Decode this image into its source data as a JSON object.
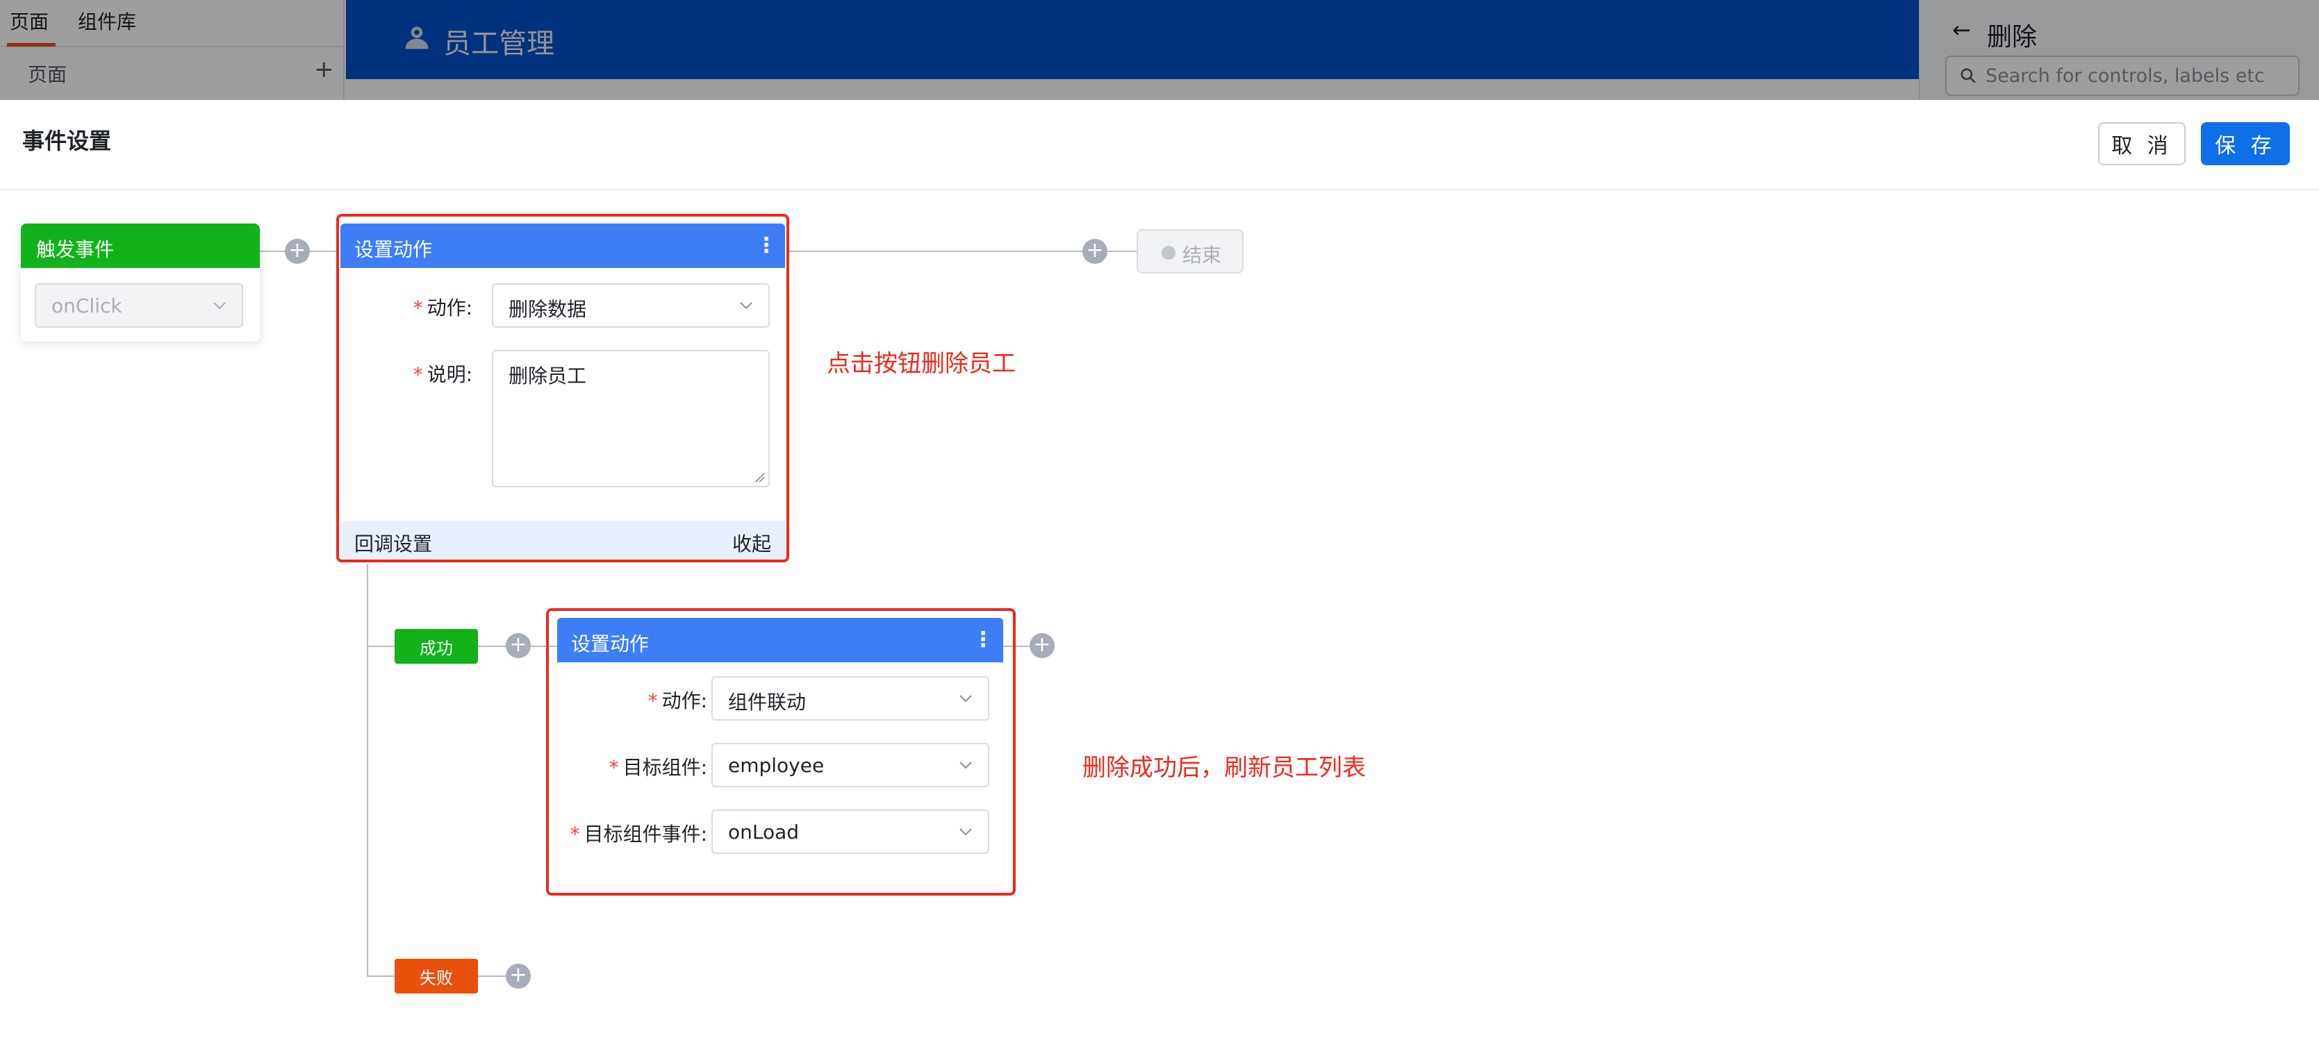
{
  "background": {
    "left_tabs": [
      "页面",
      "组件库"
    ],
    "left_subtitle": "页面",
    "left_add": "+",
    "header_title": "员工管理",
    "right_back": "←",
    "right_title": "删除",
    "search_placeholder": "Search for controls, labels etc"
  },
  "dialog": {
    "title": "事件设置",
    "cancel_label": "取 消",
    "save_label": "保 存"
  },
  "trigger": {
    "title": "触发事件",
    "event_value": "onClick"
  },
  "action1": {
    "title": "设置动作",
    "menu": "⋮",
    "action_label": "动作:",
    "action_value": "删除数据",
    "desc_label": "说明:",
    "desc_value": "删除员工",
    "callback_label": "回调设置",
    "collapse_label": "收起",
    "note": "点击按钮删除员工"
  },
  "branches": {
    "success_label": "成功",
    "fail_label": "失败"
  },
  "action2": {
    "title": "设置动作",
    "menu": "⋮",
    "action_label": "动作:",
    "action_value": "组件联动",
    "target_label": "目标组件:",
    "target_value": "employee",
    "event_label": "目标组件事件:",
    "event_value": "onLoad",
    "note": "删除成功后，刷新员工列表"
  },
  "end": {
    "label": "结束"
  },
  "required_mark": "*",
  "plus": "+",
  "colors": {
    "primary": "#0e6fe8",
    "action_header": "#3d7ef7",
    "trigger_green": "#11b21a",
    "success_green": "#11b21a",
    "fail_orange": "#e8500c",
    "annotation_red": "#ee2a1c",
    "header_blue": "#0052cc"
  }
}
